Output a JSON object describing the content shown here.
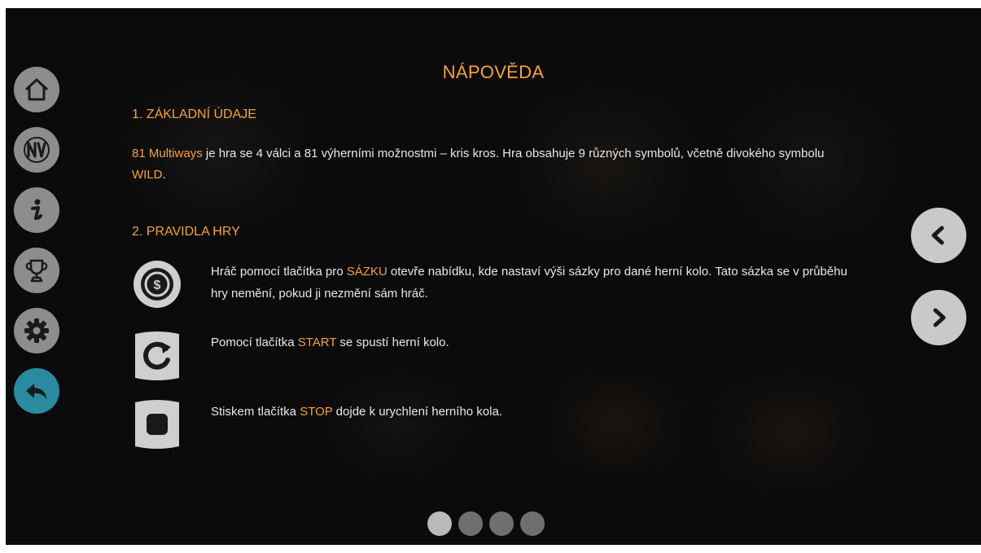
{
  "page": {
    "title": "NÁPOVĚDA",
    "accent_color": "#f4a23a",
    "active_menu_color": "#2a8aa0"
  },
  "section1": {
    "heading": "1. ZÁKLADNÍ ÚDAJE",
    "game_name": "81 Multiways",
    "text_a": " je hra se 4 válci a 81 výherními možnostmi – kris kros. Hra obsahuje 9 různých symbolů, včetně divokého symbolu ",
    "wild_word": "WILD",
    "text_b": "."
  },
  "section2": {
    "heading": "2. PRAVIDLA HRY",
    "rules": [
      {
        "icon": "bet-coin-icon",
        "before": "Hráč pomocí tlačítka pro ",
        "keyword": "SÁZKU",
        "after": " otevře nabídku, kde nastaví výši sázky pro dané herní kolo. Tato sázka se v průběhu hry nemění, pokud ji nezmění sám hráč."
      },
      {
        "icon": "start-refresh-icon",
        "before": "Pomocí tlačítka ",
        "keyword": "START",
        "after": " se spustí herní kolo."
      },
      {
        "icon": "stop-square-icon",
        "before": "Stiskem tlačítka ",
        "keyword": "STOP",
        "after": " dojde k urychlení herního kola."
      }
    ]
  },
  "side_menu": [
    {
      "icon": "home-icon"
    },
    {
      "icon": "paytable-icon"
    },
    {
      "icon": "info-icon"
    },
    {
      "icon": "trophy-icon"
    },
    {
      "icon": "settings-gear-icon"
    },
    {
      "icon": "back-arrow-icon",
      "active": true
    }
  ],
  "pagination": {
    "total": 4,
    "current": 1
  }
}
